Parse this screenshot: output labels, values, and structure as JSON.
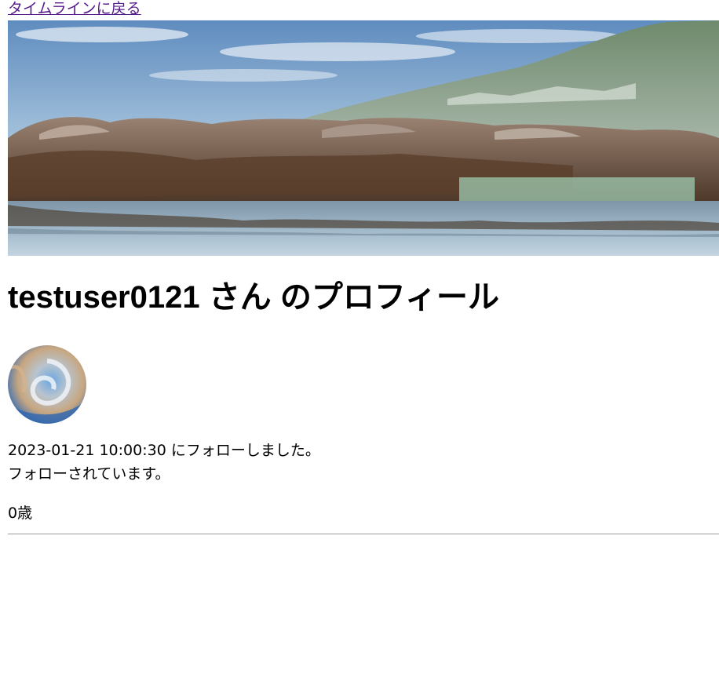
{
  "nav": {
    "back_label": "タイムラインに戻る"
  },
  "header_image": {
    "alt": "rocky coastline with hills reflected in calm water"
  },
  "profile": {
    "title": "testuser0121 さん のプロフィール",
    "avatar_alt": "abstract wave swirl avatar",
    "followed_at": "2023-01-21 10:00:30 にフォローしました。",
    "followed_by": "フォローされています。",
    "age": "0歳"
  },
  "colors": {
    "link": "#551a8b",
    "divider": "#9a9a9a",
    "text": "#000000",
    "background": "#ffffff"
  }
}
